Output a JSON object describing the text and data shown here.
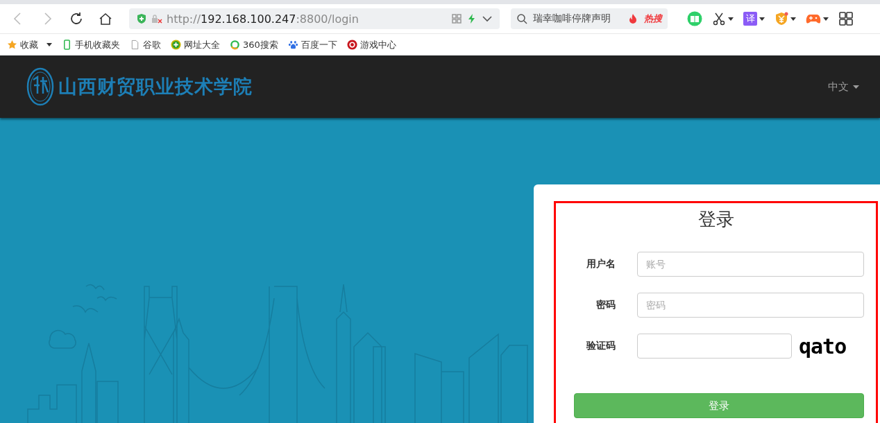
{
  "browser": {
    "url": {
      "scheme": "http://",
      "host": "192.168.100.247",
      "path": ":8800/login"
    },
    "search": {
      "value": "瑞幸咖啡停牌声明",
      "hot_label": "热搜"
    },
    "translate_label": "译",
    "bookmarks": [
      {
        "label": "收藏",
        "kind": "star"
      },
      {
        "label": "手机收藏夹",
        "kind": "phone"
      },
      {
        "label": "谷歌",
        "kind": "page"
      },
      {
        "label": "网址大全",
        "kind": "plus"
      },
      {
        "label": "360搜索",
        "kind": "ring"
      },
      {
        "label": "百度一下",
        "kind": "paw"
      },
      {
        "label": "游戏中心",
        "kind": "game"
      }
    ]
  },
  "header": {
    "title": "山西财贸职业技术学院",
    "language": "中文"
  },
  "login": {
    "title": "登录",
    "fields": [
      {
        "label": "用户名",
        "placeholder": "账号",
        "kind": "text"
      },
      {
        "label": "密码",
        "placeholder": "密码",
        "kind": "password"
      },
      {
        "label": "验证码",
        "kind": "captcha",
        "captcha_text": "qato"
      }
    ],
    "submit": "登录"
  }
}
